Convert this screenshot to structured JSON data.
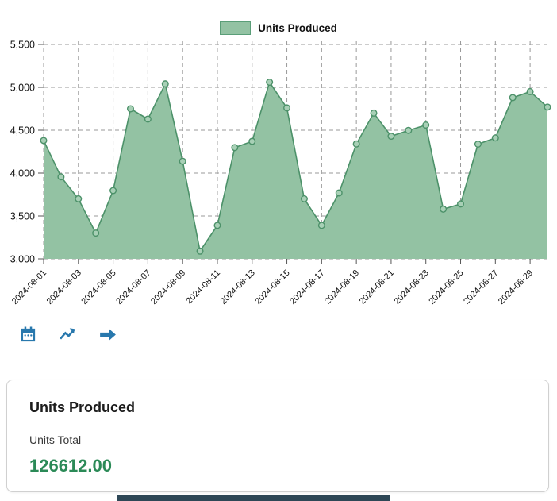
{
  "legend": {
    "label": "Units Produced"
  },
  "chart_data": {
    "type": "area",
    "title": "Units Produced",
    "series_name": "Units Produced",
    "x": [
      "2024-08-01",
      "2024-08-02",
      "2024-08-03",
      "2024-08-04",
      "2024-08-05",
      "2024-08-06",
      "2024-08-07",
      "2024-08-08",
      "2024-08-09",
      "2024-08-10",
      "2024-08-11",
      "2024-08-12",
      "2024-08-13",
      "2024-08-14",
      "2024-08-15",
      "2024-08-16",
      "2024-08-17",
      "2024-08-18",
      "2024-08-19",
      "2024-08-20",
      "2024-08-21",
      "2024-08-22",
      "2024-08-23",
      "2024-08-24",
      "2024-08-25",
      "2024-08-26",
      "2024-08-27",
      "2024-08-28",
      "2024-08-29",
      "2024-08-30"
    ],
    "values": [
      4380,
      3956,
      3700,
      3300,
      3796,
      4750,
      4630,
      5040,
      4138,
      3090,
      3390,
      4298,
      4370,
      5060,
      4760,
      3700,
      3390,
      3768,
      4340,
      4700,
      4430,
      4498,
      4560,
      3580,
      3640,
      4338,
      4410,
      4880,
      4950,
      4770
    ],
    "ylim": [
      3000,
      5500
    ],
    "ytick_step": 500,
    "x_label_every": 2,
    "grid": "dashed",
    "legend_position": "top-center"
  },
  "toolbar": {
    "icons": [
      {
        "name": "calendar"
      },
      {
        "name": "trend"
      },
      {
        "name": "arrow-right"
      }
    ]
  },
  "card": {
    "title": "Units Produced",
    "subtitle": "Units Total",
    "total": "126612.00"
  },
  "colors": {
    "area_fill": "#93c2a3",
    "line": "#4c9169",
    "marker_fill": "#a8d0b6",
    "grid": "#999999",
    "tick": "#555555",
    "axis_text": "#111111",
    "icon_blue": "#2878ad",
    "total_green": "#2b8a57",
    "bottom_bar": "#2e4756"
  }
}
